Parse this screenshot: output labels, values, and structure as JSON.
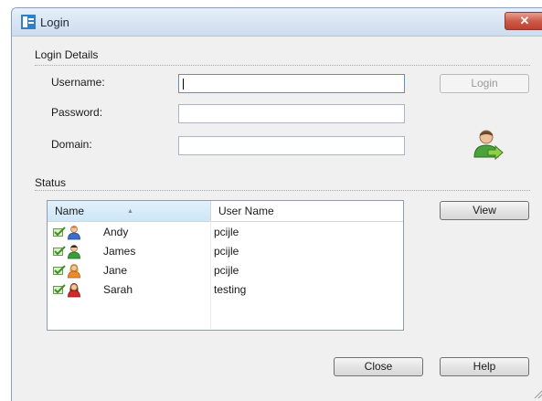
{
  "window": {
    "title": "Login",
    "close_glyph": "✕"
  },
  "login_details": {
    "group_label": "Login Details",
    "username_label": "Username:",
    "username_value": "",
    "password_label": "Password:",
    "password_value": "",
    "domain_label": "Domain:",
    "domain_value": "",
    "login_button": "Login"
  },
  "status": {
    "group_label": "Status",
    "columns": [
      "Name",
      "User Name"
    ],
    "rows": [
      {
        "name": "Andy",
        "user_name": "pcijle",
        "icon": "user-blue-icon"
      },
      {
        "name": "James",
        "user_name": "pcijle",
        "icon": "user-green-icon"
      },
      {
        "name": "Jane",
        "user_name": "pcijle",
        "icon": "user-orange-icon"
      },
      {
        "name": "Sarah",
        "user_name": "testing",
        "icon": "user-red-icon"
      }
    ],
    "view_button": "View"
  },
  "footer": {
    "close_button": "Close",
    "help_button": "Help"
  },
  "colors": {
    "titlebar": "#d9e5f3",
    "close_red": "#cc5b48",
    "window_bg": "#f0f0f0",
    "check_green": "#5aa53a"
  }
}
